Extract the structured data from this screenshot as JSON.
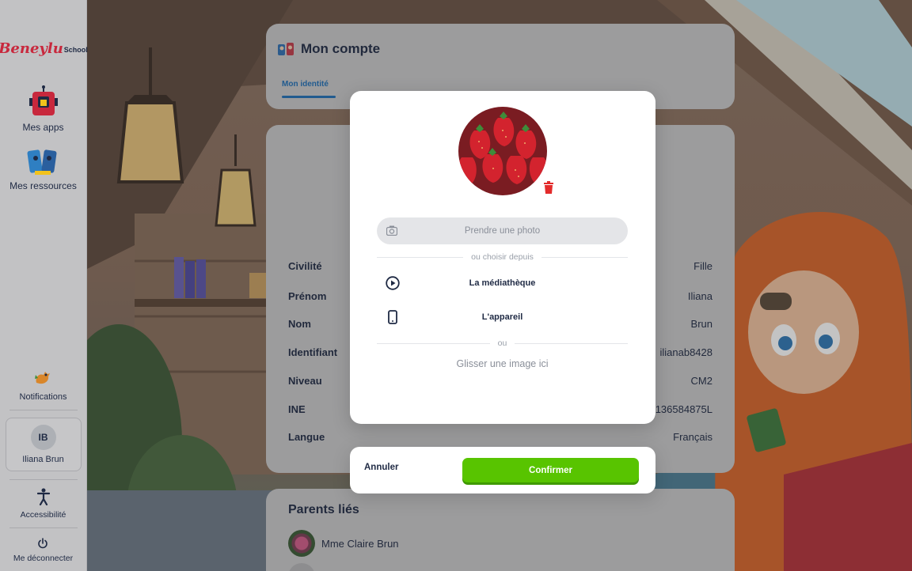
{
  "sidebar": {
    "logo_brand": "Beneylu",
    "logo_product": "School",
    "items": [
      {
        "label": "Mes apps"
      },
      {
        "label": "Mes ressources"
      }
    ],
    "notifications_label": "Notifications",
    "user": {
      "initials": "IB",
      "name": "Iliana Brun"
    },
    "accessibility_label": "Accessibilité",
    "logout_label": "Me déconnecter"
  },
  "account": {
    "title": "Mon compte",
    "tab_identity": "Mon identité"
  },
  "identity": {
    "rows": [
      {
        "label": "Civilité",
        "value": "Fille"
      },
      {
        "label": "Prénom",
        "value": "Iliana"
      },
      {
        "label": "Nom",
        "value": "Brun"
      },
      {
        "label": "Identifiant",
        "value": "ilianab8428"
      },
      {
        "label": "Niveau",
        "value": "CM2"
      },
      {
        "label": "INE",
        "value": "136584875L"
      },
      {
        "label": "Langue",
        "value": "Français"
      }
    ]
  },
  "parents": {
    "title": "Parents liés",
    "items": [
      {
        "name": "Mme Claire Brun"
      }
    ]
  },
  "modal": {
    "take_photo_label": "Prendre une photo",
    "or_choose_from": "ou choisir depuis",
    "library_label": "La médiathèque",
    "device_label": "L'appareil",
    "or_label": "ou",
    "drop_label": "Glisser une image ici",
    "cancel_label": "Annuler",
    "confirm_label": "Confirmer"
  },
  "colors": {
    "accent_blue": "#1f6fb7",
    "confirm_green": "#58c400",
    "trash_red": "#e32b2b",
    "brand_red": "#c8283d"
  }
}
